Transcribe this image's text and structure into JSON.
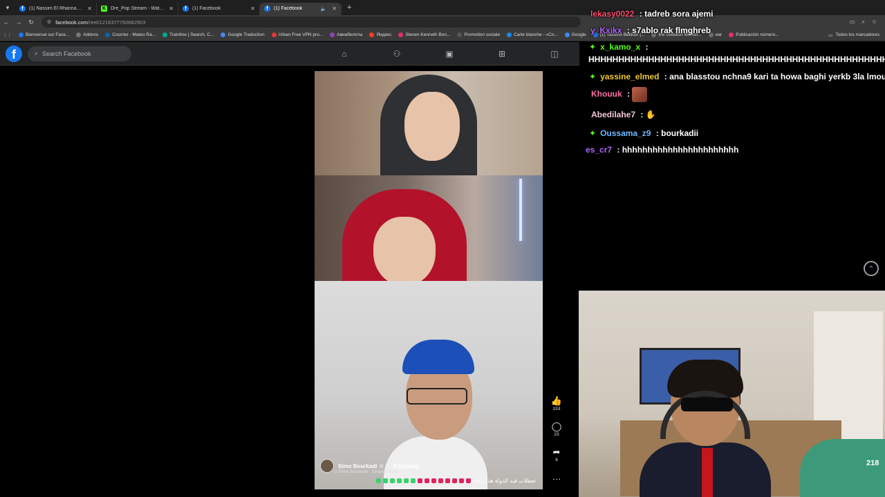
{
  "browser": {
    "tabs": [
      {
        "title": "(1) Nassim El Rhannam | Faceb",
        "favicon": "f",
        "active": false
      },
      {
        "title": "Dre_Pop Stream - Watch Live o",
        "favicon": "K",
        "active": false
      },
      {
        "title": "(1) Facebook",
        "favicon": "f",
        "active": false
      },
      {
        "title": "(1) Facebook",
        "favicon": "f",
        "active": true
      }
    ],
    "url_host": "facebook.com",
    "url_path": "/reel/1216377760682503",
    "bookmarks": [
      {
        "label": "Bienvenue sur Face...",
        "color": "#1877f2"
      },
      {
        "label": "Addons",
        "color": "#777777"
      },
      {
        "label": "Courrier - Mateo Ra...",
        "color": "#0a64ad"
      },
      {
        "label": "Trainline | Search, C...",
        "color": "#00a88f"
      },
      {
        "label": "Google Traduction",
        "color": "#4285f4"
      },
      {
        "label": "Urban Free VPN pro...",
        "color": "#e53935"
      },
      {
        "label": "Авиабилеты",
        "color": "#8e44ad"
      },
      {
        "label": "Яндекс",
        "color": "#fc3f1d"
      },
      {
        "label": "Steven Kenneth Bon...",
        "color": "#e1306c"
      },
      {
        "label": "Promotion sociale",
        "color": "#555555"
      },
      {
        "label": "Carte blanche - «Co...",
        "color": "#1e88e5"
      },
      {
        "label": "Google",
        "color": "#4285f4"
      },
      {
        "label": "(1) Yassine Bekkari |...",
        "color": "#1877f2"
      },
      {
        "label": "the Swedish Market...",
        "color": "#6d6d6d"
      },
      {
        "label": "ear",
        "color": "#6d6d6d"
      },
      {
        "label": "Publicación número...",
        "color": "#e1306c"
      }
    ],
    "bookmarks_all": "Todos los marcadores"
  },
  "facebook": {
    "logo": "f",
    "search_placeholder": "Search Facebook",
    "nav_icons": [
      "home-icon",
      "friends-icon",
      "watch-icon",
      "marketplace-icon",
      "gaming-icon"
    ]
  },
  "reel": {
    "owner_name": "Simo Bourkadi",
    "follow_label": "Following",
    "audio": "Simo Bourkadi · Original audio",
    "caption": "تعطلات فيه الدولة هذا براف",
    "likes": "153",
    "comments": "23",
    "shares": "6",
    "more": "…"
  },
  "chat": [
    {
      "user": "lekasy0022",
      "user_color": "#ff4d6d",
      "message": "tadreb sora ajemi",
      "badge": false
    },
    {
      "user": "y_Kxikx",
      "user_color": "#b066ff",
      "message": "s7ablo rak flmghreb",
      "badge": false
    },
    {
      "user": "x_kamo_x",
      "user_color": "#53fc18",
      "message": "",
      "badge": true
    },
    {
      "user": "",
      "user_color": "#ffffff",
      "message": "HHHHHHHHHHHHHHHHHHHHHHHHHHHHHHHHHHHHHHHHHHHHHHHHHHHHHHHH",
      "badge": false
    },
    {
      "user": "yassine_elmed",
      "user_color": "#f0c93a",
      "message": "ana blasstou nchna9 kari ta howa baghi yerkb 3la lmouja",
      "badge": true
    },
    {
      "user": "Khouuk",
      "user_color": "#ff6fa5",
      "message": "",
      "badge": false
    },
    {
      "user": "Abedilahe7",
      "user_color": "#f2c6d8",
      "message": "",
      "badge": false
    },
    {
      "user": "Oussama_z9",
      "user_color": "#6fb7ff",
      "message": "bourkadii",
      "badge": true
    },
    {
      "user": "es_cr7",
      "user_color": "#b066ff",
      "message": "hhhhhhhhhhhhhhhhhhhhhhh",
      "badge": false
    }
  ],
  "webcam": {
    "shirt_number": "218"
  }
}
